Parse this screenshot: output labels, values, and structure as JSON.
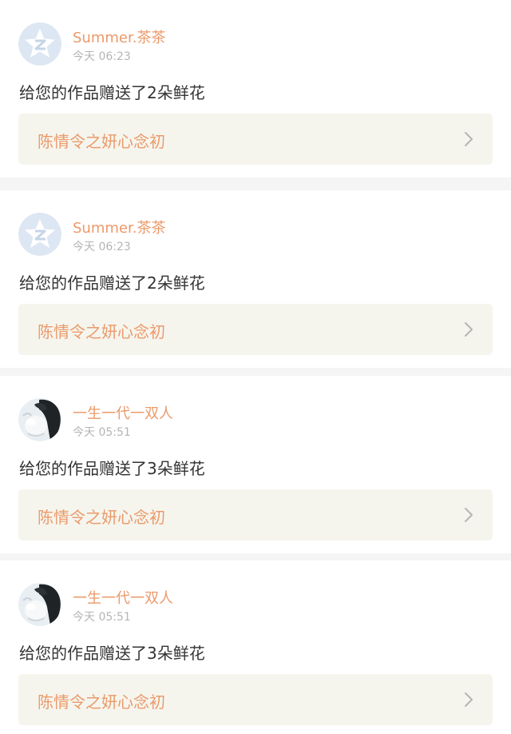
{
  "accent": {
    "orange": "#eb9a6a",
    "pink": "#e8749b"
  },
  "notifications": [
    {
      "user": "Summer.茶茶",
      "avatar": "qq-default-avatar",
      "time": "今天 06:23",
      "message": "给您的作品赠送了2朵鲜花",
      "work_title": "陈情令之妍心念初"
    },
    {
      "user": "Summer.茶茶",
      "avatar": "qq-default-avatar",
      "time": "今天 06:23",
      "message": "给您的作品赠送了2朵鲜花",
      "work_title": "陈情令之妍心念初"
    },
    {
      "user": "一生一代一双人",
      "avatar": "anime-character-avatar",
      "time": "今天 05:51",
      "message": "给您的作品赠送了3朵鲜花",
      "work_title": "陈情令之妍心念初"
    },
    {
      "user": "一生一代一双人",
      "avatar": "anime-character-avatar",
      "time": "今天 05:51",
      "message": "给您的作品赠送了3朵鲜花",
      "work_title": "陈情令之妍心念初"
    }
  ]
}
